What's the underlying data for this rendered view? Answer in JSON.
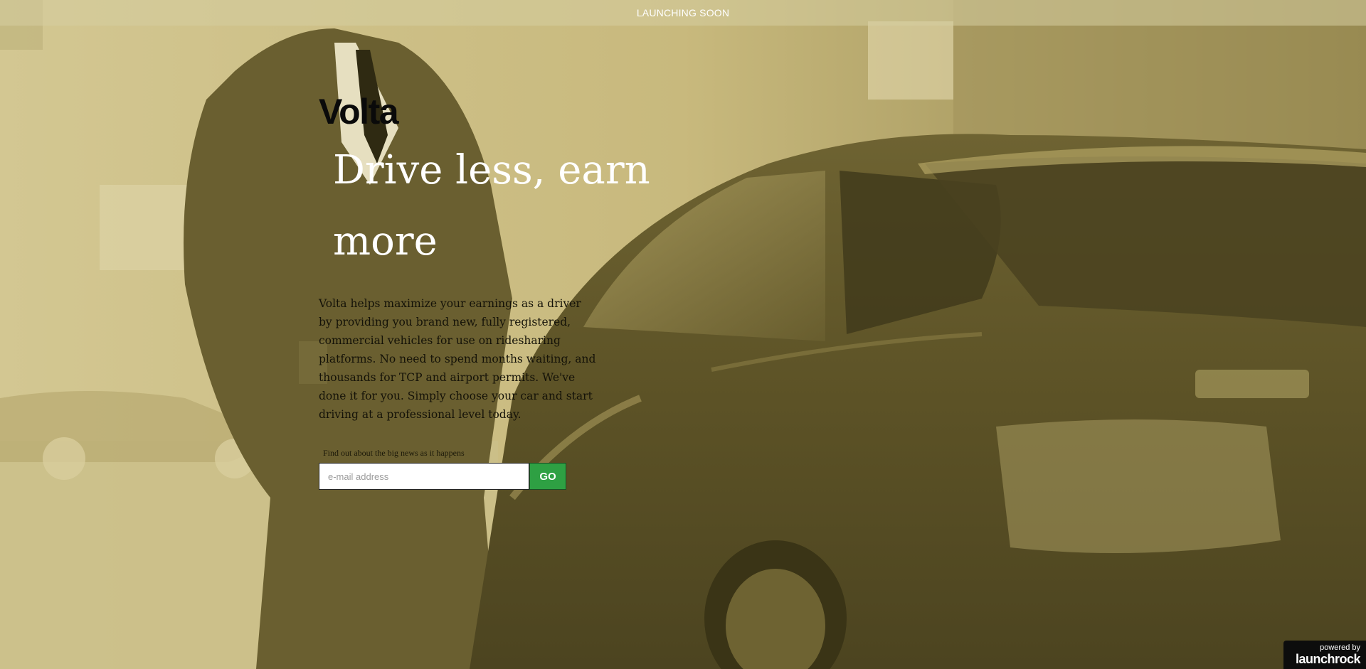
{
  "topbar": {
    "label": "LAUNCHING SOON"
  },
  "brand": {
    "logo": "Volta"
  },
  "hero": {
    "headline": "Drive less, earn more",
    "description": "Volta helps maximize your earnings as a driver by providing you brand new, fully registered, commercial vehicles for use on ridesharing platforms. No need to spend months waiting, and thousands for TCP and airport permits. We've done it for you. Simply choose your car and start driving at a professional level today."
  },
  "signup": {
    "label": "Find out about the big news as it happens",
    "email_placeholder": "e-mail address",
    "email_value": "",
    "button_label": "GO"
  },
  "badge": {
    "small": "powered by",
    "brand": "launchrock"
  },
  "colors": {
    "tint": "#cdbf86",
    "button": "#2ea043"
  }
}
